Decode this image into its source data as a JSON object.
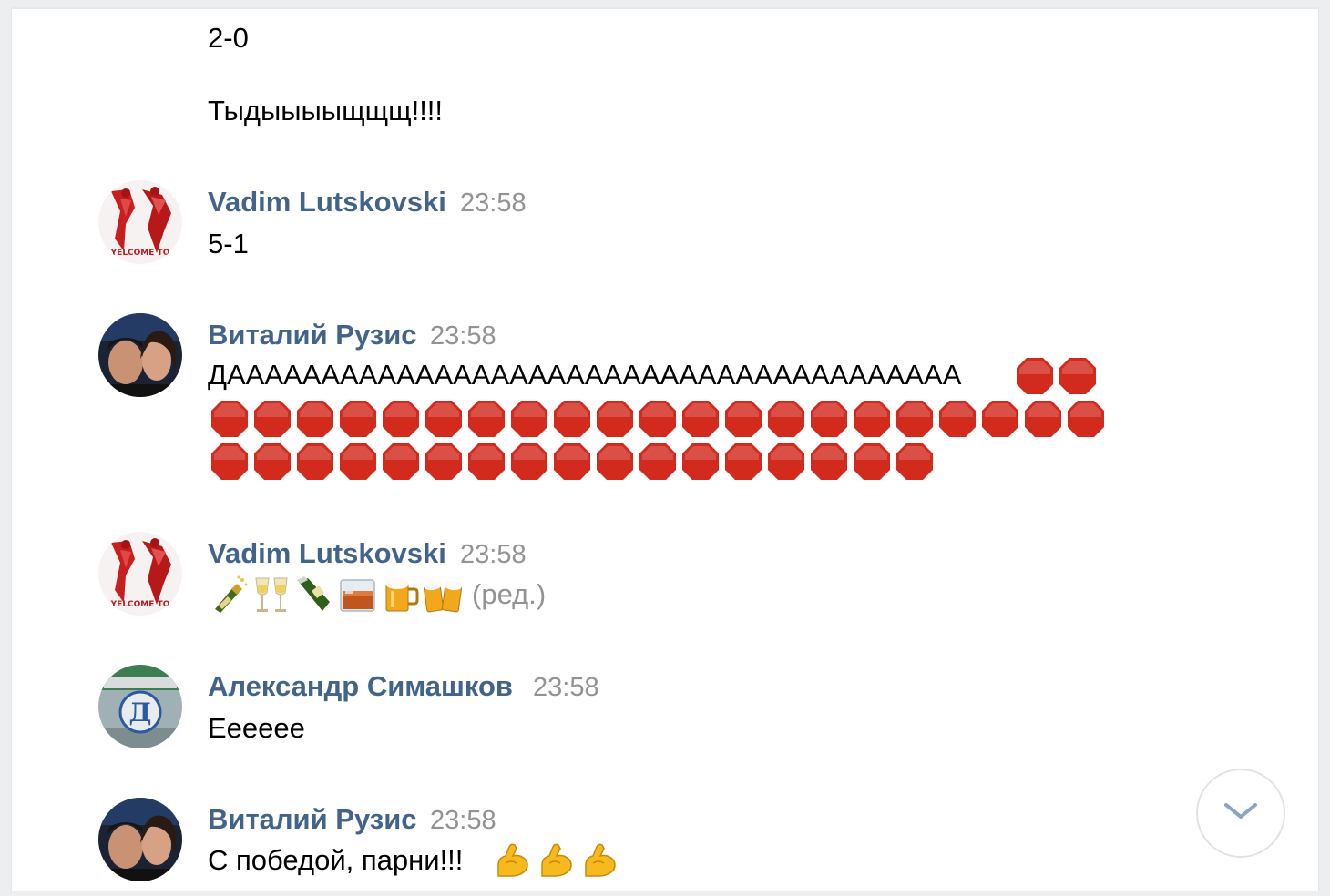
{
  "messages": [
    {
      "lines": [
        "2-0",
        "Тыдыыыыщщщ!!!!"
      ]
    },
    {
      "author": "Vadim Lutskovski",
      "time": "23:58",
      "text": "5-1",
      "avatar_icon": "red-fan-art-avatar"
    },
    {
      "author": "Виталий Рузис",
      "time": "23:58",
      "text": "ДААААААААААААААААААААААААААААААААААААААА",
      "emoji_icon": "stop-sign-icon",
      "emoji_count_line1": 2,
      "emoji_count_line2": 21,
      "emoji_count_line3": 17,
      "avatar_icon": "couple-photo-avatar"
    },
    {
      "author": "Vadim Lutskovski",
      "time": "23:58",
      "emojis": [
        "bottle-popping-icon",
        "wine-glasses-icon",
        "champagne-bottle-icon",
        "whisky-glass-icon",
        "beer-mug-icon",
        "clinking-beer-mugs-icon"
      ],
      "edited_label": "(ред.)",
      "avatar_icon": "red-fan-art-avatar"
    },
    {
      "author": "Александр Симашков",
      "time": "23:58",
      "text": "Ееееее",
      "avatar_icon": "dynamo-logo-avatar"
    },
    {
      "author": "Виталий Рузис",
      "time": "23:58",
      "text": "С победой, парни!!!",
      "emojis": [
        "flexed-biceps-icon",
        "flexed-biceps-icon",
        "flexed-biceps-icon"
      ],
      "avatar_icon": "couple-photo-avatar"
    }
  ],
  "scroll_down_icon": "chevron-down-icon",
  "colors": {
    "author": "#42648b",
    "time": "#939393",
    "stop_red": "#d32a1e",
    "background": "#edeef0"
  }
}
